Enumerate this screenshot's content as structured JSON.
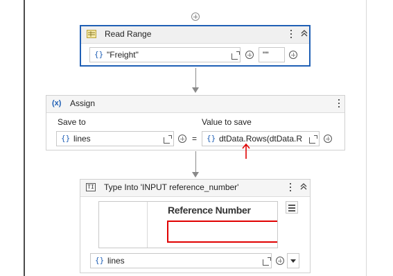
{
  "read_range": {
    "title": "Read Range",
    "sheet_value": "\"Freight\"",
    "range_value": "\"\""
  },
  "assign": {
    "title": "Assign",
    "icon_text": "(x)",
    "save_to_label": "Save to",
    "save_to_value": "lines",
    "equals": "=",
    "value_label": "Value to save",
    "value_value": "dtData.Rows(dtData.Ro"
  },
  "type_into": {
    "title": "Type Into 'INPUT  reference_number'",
    "preview_label": "Reference Number",
    "text_value": "lines"
  },
  "colors": {
    "selected_border": "#1f5fb5",
    "annotation_arrow": "#e00000",
    "highlight_box": "#e00000"
  }
}
